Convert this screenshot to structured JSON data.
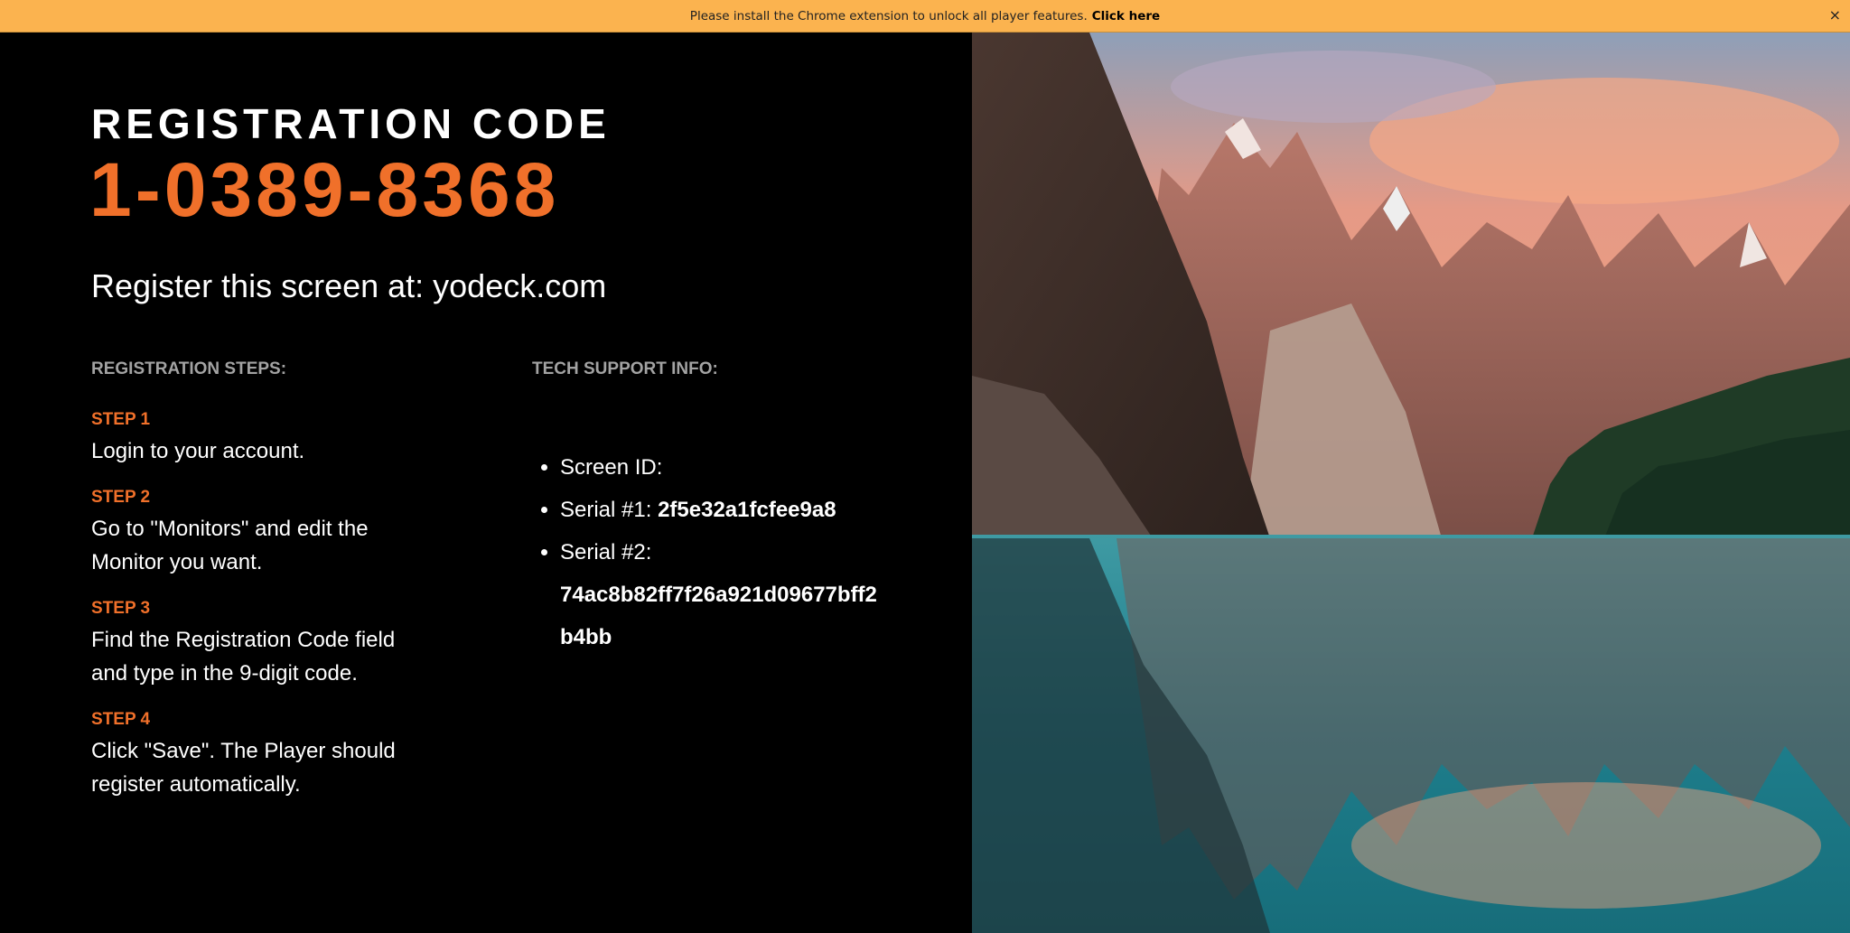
{
  "banner": {
    "message": "Please install the Chrome extension to unlock all player features.",
    "link_label": "Click here",
    "close_glyph": "×"
  },
  "registration": {
    "title": "REGISTRATION CODE",
    "code": "1-0389-8368",
    "register_text": "Register this screen at: yodeck.com"
  },
  "steps": {
    "heading": "REGISTRATION STEPS:",
    "items": [
      {
        "label": "STEP 1",
        "text": "Login to your account."
      },
      {
        "label": "STEP 2",
        "text": "Go to \"Monitors\" and edit the Monitor you want."
      },
      {
        "label": "STEP 3",
        "text": "Find the Registration Code field and type in the 9-digit code."
      },
      {
        "label": "STEP 4",
        "text": "Click \"Save\". The Player should register automatically."
      }
    ]
  },
  "support": {
    "heading": "TECH SUPPORT INFO:",
    "screen_id_label": "Screen ID:",
    "serial1_label": "Serial #1:",
    "serial1_value": "2f5e32a1fcfee9a8",
    "serial2_label": "Serial #2:",
    "serial2_value": "74ac8b82ff7f26a921d09677bff2b4bb"
  },
  "colors": {
    "accent": "#f0702a",
    "banner_bg": "#fbb34f",
    "muted": "#a3a3a3"
  },
  "icons": {
    "close": "close-icon"
  }
}
